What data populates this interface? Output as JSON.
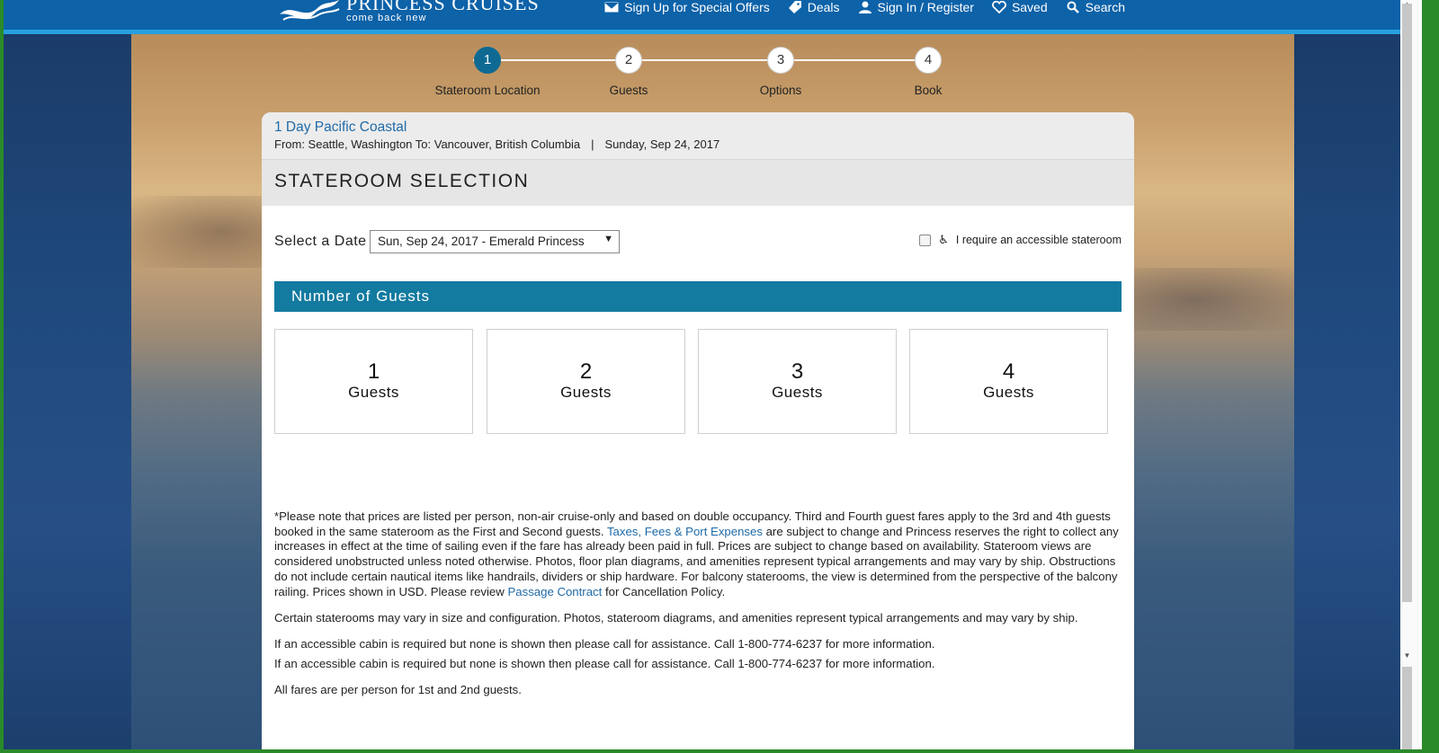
{
  "header": {
    "brand": "PRINCESS CRUISES",
    "tagline": "come back new",
    "nav": [
      {
        "label": "Sign Up for Special Offers",
        "icon": "envelope-icon"
      },
      {
        "label": "Deals",
        "icon": "tag-icon"
      },
      {
        "label": "Sign In / Register",
        "icon": "user-icon"
      },
      {
        "label": "Saved",
        "icon": "heart-icon"
      },
      {
        "label": "Search",
        "icon": "search-icon"
      }
    ]
  },
  "steps": [
    {
      "number": "1",
      "label": "Stateroom Location",
      "active": true
    },
    {
      "number": "2",
      "label": "Guests"
    },
    {
      "number": "3",
      "label": "Options"
    },
    {
      "number": "4",
      "label": "Book"
    }
  ],
  "cruise": {
    "title": "1 Day Pacific Coastal",
    "route": "From: Seattle, Washington To: Vancouver, British Columbia",
    "separator": "|",
    "date": "Sunday, Sep 24, 2017"
  },
  "section_title": "STATEROOM SELECTION",
  "date_select": {
    "label": "Select a Date",
    "value": "Sun, Sep 24, 2017 - Emerald Princess",
    "arrow": "▼"
  },
  "accessible": {
    "checked": false,
    "label": "I require an accessible stateroom",
    "icon_glyph": "♿"
  },
  "guests": {
    "header": "Number of Guests",
    "options": [
      {
        "number": "1",
        "label": "Guests"
      },
      {
        "number": "2",
        "label": "Guests"
      },
      {
        "number": "3",
        "label": "Guests"
      },
      {
        "number": "4",
        "label": "Guests"
      }
    ]
  },
  "notes": {
    "p1_a": "*Please note that prices are listed per person, non-air cruise-only and based on double occupancy. Third and Fourth guest fares apply to the 3rd and 4th guests booked in the same stateroom as the First and Second guests. ",
    "p1_link1": "Taxes, Fees & Port Expenses",
    "p1_b": " are subject to change and Princess reserves the right to collect any increases in effect at the time of sailing even if the fare has already been paid in full. Prices are subject to change based on availability. Stateroom views are considered unobstructed unless noted otherwise. Photos, floor plan diagrams, and amenities represent typical arrangements and may vary by ship. Obstructions do not include certain nautical items like handrails, dividers or ship hardware. For balcony staterooms, the view is determined from the perspective of the balcony railing. Prices shown in USD. Please review ",
    "p1_link2": "Passage Contract",
    "p1_c": " for Cancellation Policy.",
    "p2": "Certain staterooms may vary in size and configuration. Photos, stateroom diagrams, and amenities represent typical arrangements and may vary by ship.",
    "p3": "If an accessible cabin is required but none is shown then please call for assistance. Call 1-800-774-6237 for more information.",
    "p4": "If an accessible cabin is required but none is shown then please call for assistance. Call 1-800-774-6237 for more information.",
    "p5": "All fares are per person for 1st and 2nd guests."
  }
}
